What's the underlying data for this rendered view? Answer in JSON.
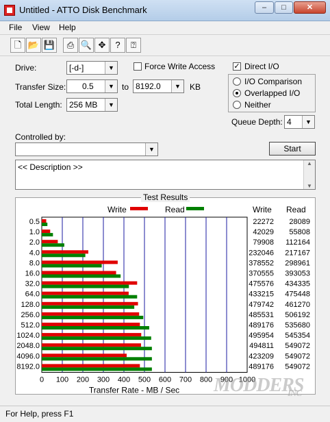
{
  "window": {
    "title": "Untitled - ATTO Disk Benchmark",
    "minimize": "–",
    "maximize": "□",
    "close": "✕"
  },
  "menu": [
    {
      "label": "File"
    },
    {
      "label": "View"
    },
    {
      "label": "Help"
    }
  ],
  "toolbar": {
    "icons": [
      "new-icon",
      "open-icon",
      "save-icon",
      "print-icon",
      "print-preview-icon",
      "move-icon",
      "help-icon",
      "context-help-icon"
    ]
  },
  "settings": {
    "drive_label": "Drive:",
    "drive_value": "[-d-]",
    "force_write_label": "Force Write Access",
    "force_write_checked": false,
    "direct_io_label": "Direct I/O",
    "direct_io_checked": true,
    "transfer_size_label": "Transfer Size:",
    "transfer_from": "0.5",
    "to_label": "to",
    "transfer_to": "8192.0",
    "kb_label": "KB",
    "total_length_label": "Total Length:",
    "total_length": "256 MB",
    "io_modes": [
      {
        "label": "I/O Comparison",
        "selected": false
      },
      {
        "label": "Overlapped I/O",
        "selected": true
      },
      {
        "label": "Neither",
        "selected": false
      }
    ],
    "queue_depth_label": "Queue Depth:",
    "queue_depth": "4",
    "controlled_by_label": "Controlled by:",
    "controlled_by_value": "",
    "start_label": "Start",
    "description": "<< Description >>"
  },
  "results": {
    "title": "Test Results",
    "write_legend": "Write",
    "read_legend": "Read",
    "col_write": "Write",
    "col_read": "Read",
    "xlabel": "Transfer Rate - MB / Sec"
  },
  "chart_data": {
    "type": "bar",
    "orientation": "horizontal",
    "title": "Test Results",
    "xlabel": "Transfer Rate - MB / Sec",
    "ylabel": "",
    "xlim": [
      0,
      1000
    ],
    "xticks": [
      "0",
      "100",
      "200",
      "300",
      "400",
      "500",
      "600",
      "700",
      "800",
      "900",
      "1000"
    ],
    "categories": [
      "0.5",
      "1.0",
      "2.0",
      "4.0",
      "8.0",
      "16.0",
      "32.0",
      "64.0",
      "128.0",
      "256.0",
      "512.0",
      "1024.0",
      "2048.0",
      "4096.0",
      "8192.0"
    ],
    "series": [
      {
        "name": "Write",
        "color": "#e00000",
        "values": [
          21.7,
          41.0,
          78.0,
          226.6,
          369.7,
          361.9,
          464.4,
          423.1,
          468.5,
          474.1,
          477.7,
          484.3,
          483.2,
          413.3,
          477.7
        ]
      },
      {
        "name": "Read",
        "color": "#008000",
        "values": [
          27.4,
          54.5,
          109.7,
          212.1,
          291.9,
          383.8,
          424.2,
          464.3,
          450.4,
          494.2,
          523.1,
          532.6,
          536.2,
          536.2,
          536.2
        ]
      }
    ],
    "table": {
      "write": [
        "22272",
        "42029",
        "79908",
        "232046",
        "378552",
        "370555",
        "475576",
        "433215",
        "479742",
        "485531",
        "489176",
        "495954",
        "494811",
        "423209",
        "489176"
      ],
      "read": [
        "28089",
        "55808",
        "112164",
        "217167",
        "298961",
        "393053",
        "434335",
        "475448",
        "461270",
        "506192",
        "535680",
        "545354",
        "549072",
        "549072",
        "549072"
      ]
    },
    "grid": true,
    "legend": "top"
  },
  "status": {
    "text": "For Help, press F1"
  },
  "watermark": {
    "line1": "MODDERS",
    "line2": "INC"
  }
}
